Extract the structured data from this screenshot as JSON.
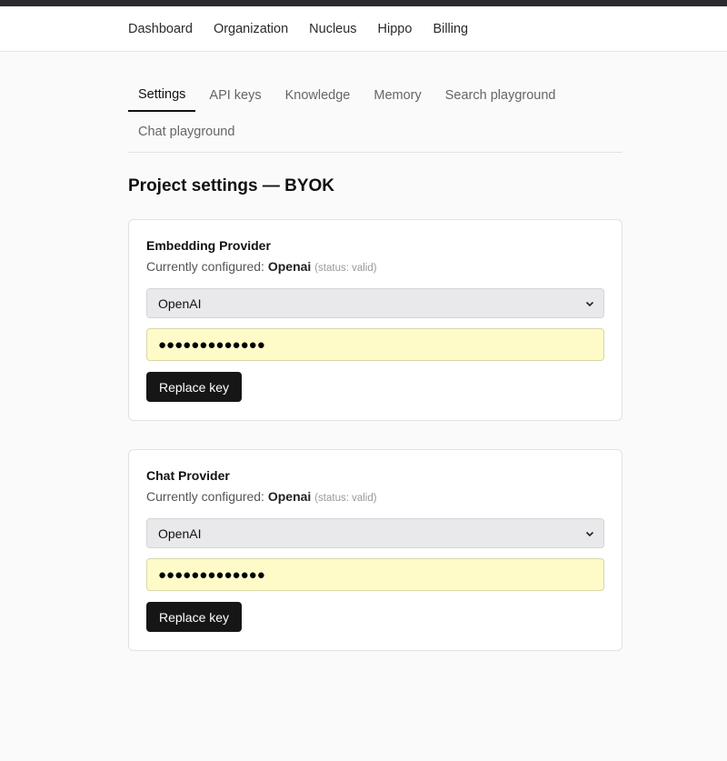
{
  "nav": {
    "items": [
      "Dashboard",
      "Organization",
      "Nucleus",
      "Hippo",
      "Billing"
    ]
  },
  "tabs": [
    "Settings",
    "API keys",
    "Knowledge",
    "Memory",
    "Search playground",
    "Chat playground"
  ],
  "active_tab": "Settings",
  "page_title": "Project settings — BYOK",
  "cards": [
    {
      "title": "Embedding Provider",
      "configured_prefix": "Currently configured:",
      "configured_provider": "Openai",
      "status": "(status: valid)",
      "select_value": "OpenAI",
      "key_mask": "●●●●●●●●●●●●●",
      "button_label": "Replace key"
    },
    {
      "title": "Chat Provider",
      "configured_prefix": "Currently configured:",
      "configured_provider": "Openai",
      "status": "(status: valid)",
      "select_value": "OpenAI",
      "key_mask": "●●●●●●●●●●●●●",
      "button_label": "Replace key"
    }
  ]
}
